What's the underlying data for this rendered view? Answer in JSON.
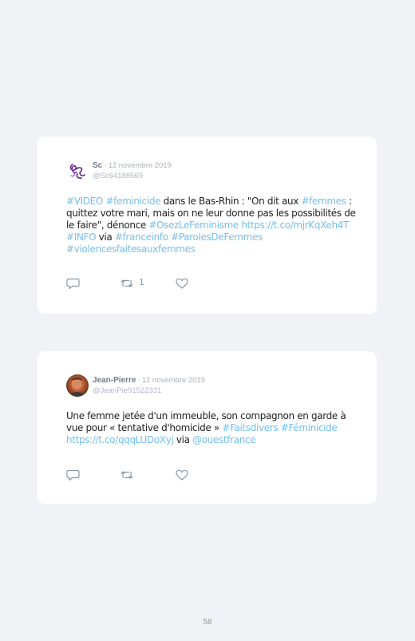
{
  "tweets": [
    {
      "author": "Sc",
      "date": "12 novembre 2019",
      "handle": "@Sc64188569",
      "segments": [
        {
          "t": "#VIDEO",
          "link": true
        },
        {
          "t": " ",
          "link": false
        },
        {
          "t": "#feminicide",
          "link": true
        },
        {
          "t": " dans le Bas-Rhin : \"On dit aux ",
          "link": false
        },
        {
          "t": "#femmes",
          "link": true
        },
        {
          "t": " : quittez votre mari, mais on ne leur donne pas les possibilités de le faire\", dénonce ",
          "link": false
        },
        {
          "t": "#OsezLeFeminisme",
          "link": true
        },
        {
          "t": " ",
          "link": false
        },
        {
          "t": "https://t.co/mjrKqXeh4T",
          "link": true
        },
        {
          "t": " ",
          "link": false
        },
        {
          "t": "#INFO",
          "link": true
        },
        {
          "t": " via ",
          "link": false
        },
        {
          "t": "#franceinfo",
          "link": true
        },
        {
          "t": " ",
          "link": false
        },
        {
          "t": "#ParolesDeFemmes",
          "link": true
        },
        {
          "t": " ",
          "link": false
        },
        {
          "t": "#violencesfaitesauxfemmes",
          "link": true
        }
      ],
      "retweet_count": "1",
      "avatar": "purple-calligraphy-logo",
      "avatar_color": "#7a3fa0"
    },
    {
      "author": "Jean-Pierre",
      "date": "12 novembre 2019",
      "handle": "@JeanPie91522331",
      "segments": [
        {
          "t": "Une femme jetée d'un immeuble, son compagnon en garde à vue pour « tentative d'homicide » ",
          "link": false
        },
        {
          "t": "#Faitsdivers",
          "link": true
        },
        {
          "t": " ",
          "link": false
        },
        {
          "t": "#Féminicide",
          "link": true
        },
        {
          "t": " ",
          "link": false
        },
        {
          "t": "https://t.co/qqqLUDoXyj",
          "link": true
        },
        {
          "t": " via ",
          "link": false
        },
        {
          "t": "@ouestfrance",
          "link": true
        }
      ],
      "retweet_count": "",
      "avatar": "profile-photo",
      "avatar_color": "#b0552d"
    }
  ],
  "page_number": "58",
  "colors": {
    "background": "#f1f2f6",
    "card": "#ffffff",
    "link": "#74c0ec",
    "author": "#6e7b8b",
    "meta": "#a9b1ba",
    "icon": "#8899a6"
  },
  "icons": [
    "reply-icon",
    "retweet-icon",
    "like-icon"
  ]
}
